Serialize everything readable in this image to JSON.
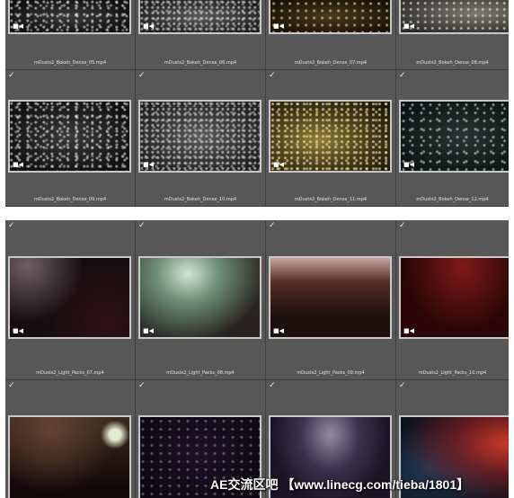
{
  "watermark": "AE交流区吧 【www.linecg.com/tieba/1801】",
  "icons": {
    "check": "checkmark-icon",
    "video": "video-icon"
  },
  "glyphs": {
    "check": "✓",
    "video": "■◀"
  },
  "top_grid": {
    "row1": [
      "mDusts2_Bokeh_Dense_05.mp4",
      "mDusts2_Bokeh_Dense_06.mp4",
      "mDusts2_Bokeh_Dense_07.mp4",
      "mDusts2_Bokeh_Dense_08.mp4"
    ],
    "row2": [
      "mDusts2_Bokeh_Dense_09.mp4",
      "mDusts2_Bokeh_Dense_10.mp4",
      "mDusts2_Bokeh_Dense_11.mp4",
      "mDusts2_Bokeh_Dense_12.mp4"
    ]
  },
  "bottom_grid": {
    "row1": [
      "mDusts2_Light_Packs_07.mp4",
      "mDusts2_Light_Packs_08.mp4",
      "mDusts2_Light_Packs_09.mp4",
      "mDusts2_Light_Packs_10.mp4"
    ]
  }
}
